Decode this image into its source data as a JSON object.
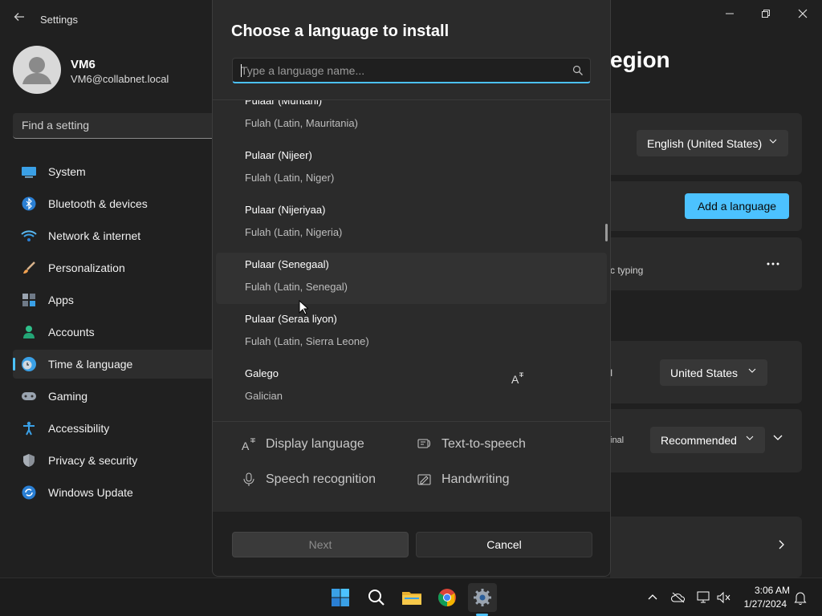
{
  "app": {
    "title": "Settings",
    "back_icon": "back-arrow-icon"
  },
  "user": {
    "name": "VM6",
    "email": "VM6@collabnet.local"
  },
  "search": {
    "placeholder": "Find a setting"
  },
  "sidebar": {
    "items": [
      {
        "label": "System",
        "icon": "system-icon"
      },
      {
        "label": "Bluetooth & devices",
        "icon": "bluetooth-icon"
      },
      {
        "label": "Network & internet",
        "icon": "network-icon"
      },
      {
        "label": "Personalization",
        "icon": "brush-icon"
      },
      {
        "label": "Apps",
        "icon": "apps-icon"
      },
      {
        "label": "Accounts",
        "icon": "accounts-icon"
      },
      {
        "label": "Time & language",
        "icon": "time-language-icon",
        "active": true
      },
      {
        "label": "Gaming",
        "icon": "gaming-icon"
      },
      {
        "label": "Accessibility",
        "icon": "accessibility-icon"
      },
      {
        "label": "Privacy & security",
        "icon": "shield-icon"
      },
      {
        "label": "Windows Update",
        "icon": "update-icon"
      }
    ]
  },
  "page": {
    "heading_fragment": "egion",
    "display_language_value": "English (United States)",
    "add_language_label": "Add a language",
    "typing_fragment": "c typing",
    "country_fragment": "I",
    "country_value": "United States",
    "regional_fragment": "inal",
    "format_value": "Recommended"
  },
  "dialog": {
    "title": "Choose a language to install",
    "search_placeholder": "Type a language name...",
    "languages": [
      {
        "native": "Pulaar (Muritani)",
        "english": "Fulah (Latin, Mauritania)"
      },
      {
        "native": "Pulaar (Nijeer)",
        "english": "Fulah (Latin, Niger)"
      },
      {
        "native": "Pulaar (Nijeriyaa)",
        "english": "Fulah (Latin, Nigeria)"
      },
      {
        "native": "Pulaar (Senegaal)",
        "english": "Fulah (Latin, Senegal)"
      },
      {
        "native": "Pulaar (Seraa liyon)",
        "english": "Fulah (Latin, Sierra Leone)"
      },
      {
        "native": "Galego",
        "english": "Galician"
      }
    ],
    "features": {
      "display_language": "Display language",
      "text_to_speech": "Text-to-speech",
      "speech_recognition": "Speech recognition",
      "handwriting": "Handwriting"
    },
    "next_label": "Next",
    "cancel_label": "Cancel"
  },
  "taskbar": {
    "apps": [
      "start-icon",
      "search-icon",
      "file-explorer-icon",
      "chrome-icon",
      "settings-icon"
    ],
    "time": "3:06 AM",
    "date": "1/27/2024"
  },
  "colors": {
    "accent": "#4cc2ff",
    "background": "#202020",
    "dialog": "#2b2b2b"
  }
}
